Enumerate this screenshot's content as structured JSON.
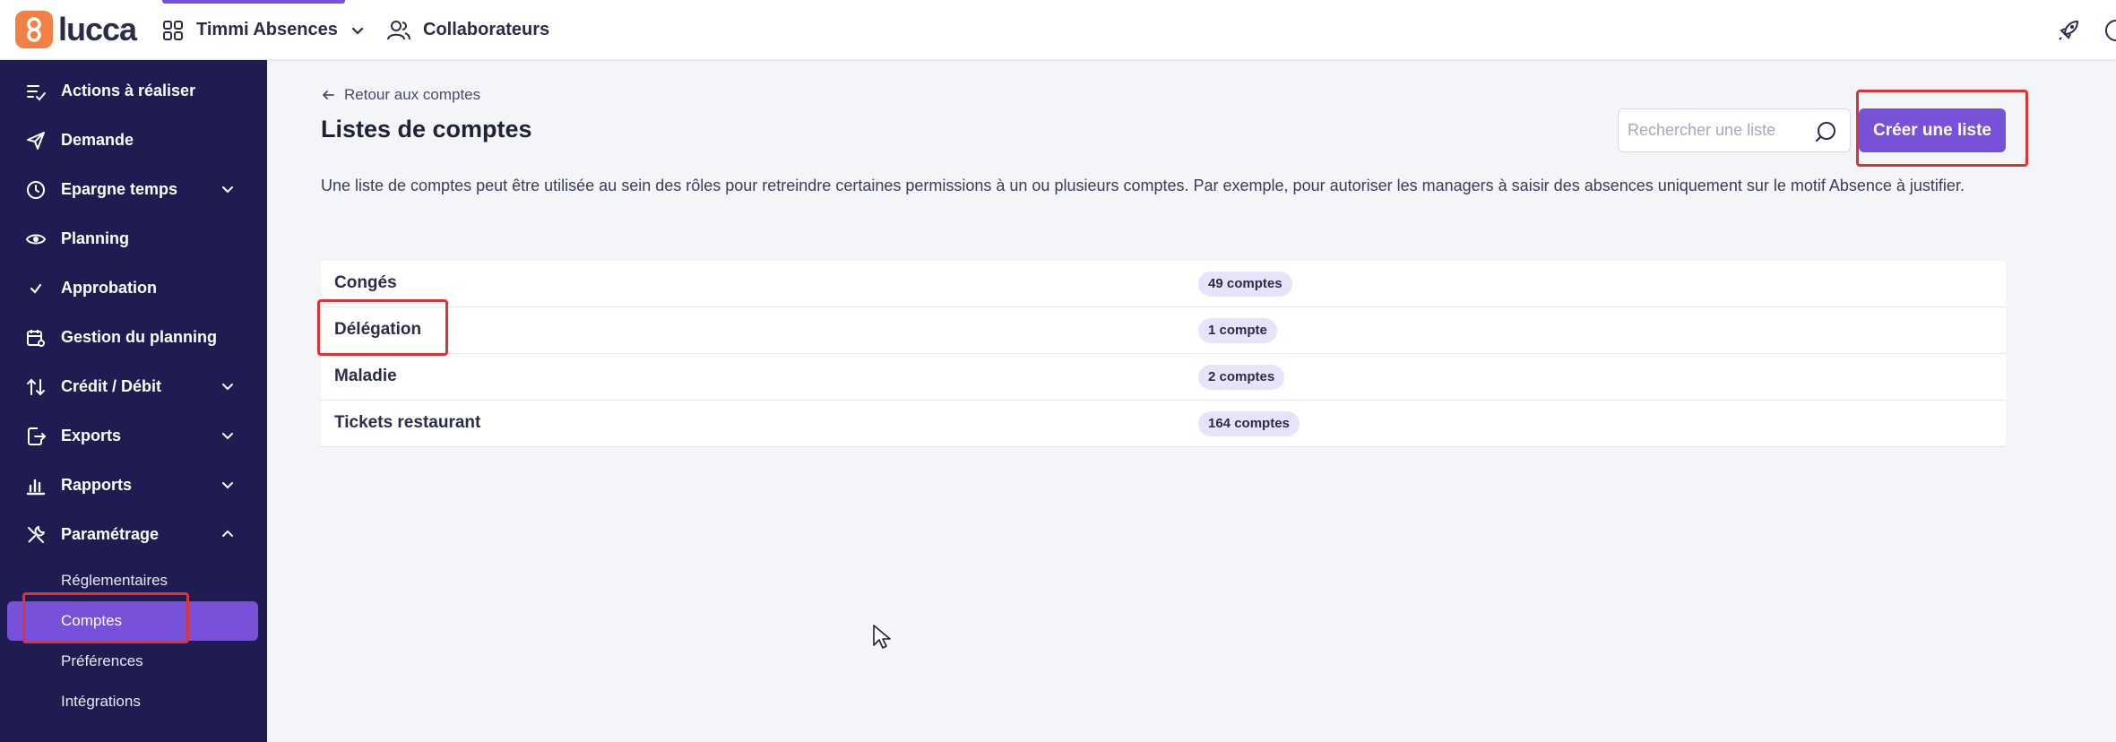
{
  "header": {
    "logo_text": "lucca",
    "app_name": "Timmi Absences",
    "nav_collab": "Collaborateurs"
  },
  "sidebar": {
    "items": [
      {
        "label": "Actions à réaliser",
        "icon": "checklist-icon",
        "expandable": false
      },
      {
        "label": "Demande",
        "icon": "send-icon",
        "expandable": false
      },
      {
        "label": "Epargne temps",
        "icon": "clock-icon",
        "expandable": true
      },
      {
        "label": "Planning",
        "icon": "eye-icon",
        "expandable": false
      },
      {
        "label": "Approbation",
        "icon": "check-icon",
        "expandable": false
      },
      {
        "label": "Gestion du planning",
        "icon": "calendar-gear-icon",
        "expandable": false
      },
      {
        "label": "Crédit / Débit",
        "icon": "arrows-updown-icon",
        "expandable": true
      },
      {
        "label": "Exports",
        "icon": "export-icon",
        "expandable": true
      },
      {
        "label": "Rapports",
        "icon": "bar-chart-icon",
        "expandable": true
      },
      {
        "label": "Paramétrage",
        "icon": "tools-icon",
        "expandable": true,
        "expanded": true
      }
    ],
    "sub_items": [
      {
        "label": "Réglementaires",
        "active": false
      },
      {
        "label": "Comptes",
        "active": true
      },
      {
        "label": "Préférences",
        "active": false
      },
      {
        "label": "Intégrations",
        "active": false
      }
    ]
  },
  "main": {
    "back_label": "Retour aux comptes",
    "title": "Listes de comptes",
    "search_placeholder": "Rechercher une liste",
    "create_label": "Créer une liste",
    "description": "Une liste de comptes peut être utilisée au sein des rôles pour retreindre certaines permissions à un ou plusieurs comptes. Par exemple, pour autoriser les managers à saisir des absences uniquement sur le motif Absence à justifier.",
    "lists": [
      {
        "name": "Congés",
        "count": "49 comptes"
      },
      {
        "name": "Délégation",
        "count": "1 compte"
      },
      {
        "name": "Maladie",
        "count": "2 comptes"
      },
      {
        "name": "Tickets restaurant",
        "count": "164 comptes"
      }
    ]
  },
  "colors": {
    "sidebar_bg": "#1e1c50",
    "accent": "#7851d9",
    "logo": "#f27f43",
    "annotation": "#e03232",
    "badge_bg": "#e7e3fa"
  }
}
